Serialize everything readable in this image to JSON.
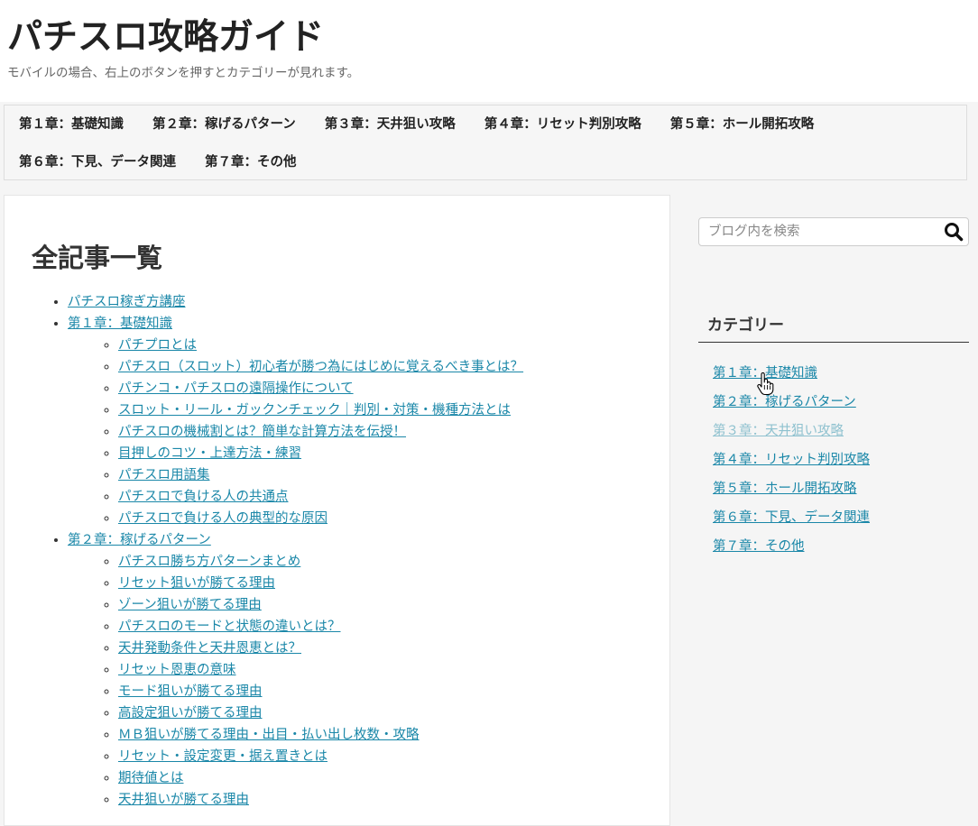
{
  "site": {
    "title": "パチスロ攻略ガイド",
    "tagline": "モバイルの場合、右上のボタンを押すとカテゴリーが見れます。"
  },
  "nav": {
    "items": [
      "第１章：基礎知識",
      "第２章：稼げるパターン",
      "第３章：天井狙い攻略",
      "第４章：リセット判別攻略",
      "第５章：ホール開拓攻略",
      "第６章：下見、データ関連",
      "第７章：その他"
    ]
  },
  "main": {
    "heading": "全記事一覧",
    "list": [
      {
        "label": "パチスロ稼ぎ方講座",
        "children": []
      },
      {
        "label": "第１章：基礎知識",
        "children": [
          "パチプロとは",
          "パチスロ（スロット）初心者が勝つ為にはじめに覚えるべき事とは？",
          "パチンコ・パチスロの遠隔操作について",
          "スロット・リール・ガックンチェック｜判別・対策・機種方法とは",
          "パチスロの機械割とは？簡単な計算方法を伝授！",
          "目押しのコツ・上達方法・練習",
          "パチスロ用語集",
          "パチスロで負ける人の共通点",
          "パチスロで負ける人の典型的な原因"
        ]
      },
      {
        "label": "第２章：稼げるパターン",
        "children": [
          "パチスロ勝ち方パターンまとめ",
          "リセット狙いが勝てる理由",
          "ゾーン狙いが勝てる理由",
          "パチスロのモードと状態の違いとは？",
          "天井発動条件と天井恩恵とは？",
          "リセット恩恵の意味",
          "モード狙いが勝てる理由",
          "高設定狙いが勝てる理由",
          "ＭＢ狙いが勝てる理由・出目・払い出し枚数・攻略",
          "リセット・設定変更・据え置きとは",
          "期待値とは",
          "天井狙いが勝てる理由"
        ]
      }
    ]
  },
  "sidebar": {
    "search_placeholder": "ブログ内を検索",
    "category_title": "カテゴリー",
    "categories": [
      {
        "label": "第１章：基礎知識",
        "visited": false
      },
      {
        "label": "第２章：稼げるパターン",
        "visited": false
      },
      {
        "label": "第３章：天井狙い攻略",
        "visited": true
      },
      {
        "label": "第４章：リセット判別攻略",
        "visited": false
      },
      {
        "label": "第５章：ホール開拓攻略",
        "visited": false
      },
      {
        "label": "第６章：下見、データ関連",
        "visited": false
      },
      {
        "label": "第７章：その他",
        "visited": false
      }
    ]
  },
  "icons": {
    "search": "search-icon",
    "cursor": "hand-pointer-icon"
  },
  "colors": {
    "link": "#1a87a8",
    "visited_link": "#8ec1cf",
    "background": "#f5f5f5"
  }
}
